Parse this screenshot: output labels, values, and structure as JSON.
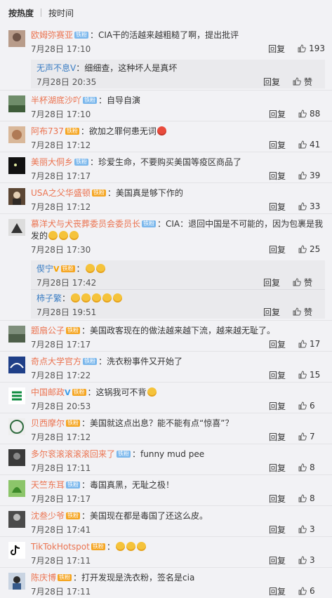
{
  "tabs": {
    "hot": "按热度",
    "time": "按时间"
  },
  "comments": [
    {
      "name": "欧姆弥赛亚",
      "badge": "铁粉",
      "text": "：CIA干的活越来越粗糙了啊，提出批评",
      "time": "7月28日 17:10",
      "reply": "回复",
      "likes": "193",
      "replies": [
        {
          "name": "无声不息V",
          "text": "：细细查，这种坏人是真坏",
          "time": "7月28日 20:35",
          "reply": "回复",
          "likes": "赞"
        }
      ]
    },
    {
      "name": "半杯湖底沙吖",
      "badge": "铁粉",
      "text": "：自导自演",
      "time": "7月28日 17:10",
      "reply": "回复",
      "likes": "88"
    },
    {
      "name": "阿布737",
      "badge": "铁粉",
      "text": "：欲加之罪何患无词",
      "time": "7月28日 17:12",
      "reply": "回复",
      "likes": "41"
    },
    {
      "name": "美丽大侗乡",
      "badge": "铁粉",
      "text": "：珍爱生命，不要购买美国等疫区商品了",
      "time": "7月28日 17:17",
      "reply": "回复",
      "likes": "39"
    },
    {
      "name": "USA之父华盛顿",
      "badge": "铁粉",
      "text": "：美国真是够下作的",
      "time": "7月28日 17:12",
      "reply": "回复",
      "likes": "33"
    },
    {
      "name": "慕洋犬与犬丧葬委员会委员长",
      "badge": "铁粉",
      "text": "：CIA：退回中国是不可能的，因为包裹是我发的",
      "time": "7月28日 17:30",
      "reply": "回复",
      "likes": "25",
      "replies": [
        {
          "name": "偰宁",
          "text": "：",
          "time": "7月28日 17:42",
          "reply": "回复",
          "likes": "赞"
        },
        {
          "name": "柿子繁",
          "text": "：",
          "time": "7月28日 19:51",
          "reply": "回复",
          "likes": "赞"
        }
      ]
    },
    {
      "name": "题扇公子",
      "badge": "铁粉",
      "text": "：美国政客现在的做法越来越下流，越来越无耻了。",
      "time": "7月28日 17:17",
      "reply": "回复",
      "likes": "17"
    },
    {
      "name": "奇点大学官方",
      "badge": "铁粉",
      "text": "：洗衣粉事件又开始了",
      "time": "7月28日 17:22",
      "reply": "回复",
      "likes": "15"
    },
    {
      "name": "中国邮政",
      "badge": "",
      "text": "：这锅我可不背",
      "time": "7月28日 20:53",
      "reply": "回复",
      "likes": "6"
    },
    {
      "name": "贝西摩尔",
      "badge": "铁粉",
      "text": "：美国就这点出息？能不能有点“惊喜”？",
      "time": "7月28日 17:12",
      "reply": "回复",
      "likes": "7"
    },
    {
      "name": "多尔衮滚滚滚滚回来了",
      "badge": "铁粉",
      "text": "：funny mud pee",
      "time": "7月28日 17:11",
      "reply": "回复",
      "likes": "8"
    },
    {
      "name": "天竺东耳",
      "badge": "铁粉",
      "text": "：毒国真黑，无耻之极！",
      "time": "7月28日 17:17",
      "reply": "回复",
      "likes": "8"
    },
    {
      "name": "沈叁少爷",
      "badge": "铁粉",
      "text": "：美国现在都是毒国了还这么皮。",
      "time": "7月28日 17:41",
      "reply": "回复",
      "likes": "3"
    },
    {
      "name": "TikTokHotspot",
      "badge": "铁粉",
      "text": "：",
      "time": "7月28日 17:11",
      "reply": "回复",
      "likes": "3"
    },
    {
      "name": "陈庆博",
      "badge": "铁粉",
      "text": "：打开发现是洗衣粉，签名是cia",
      "time": "7月28日 17:11",
      "reply": "回复",
      "likes": "6"
    }
  ]
}
